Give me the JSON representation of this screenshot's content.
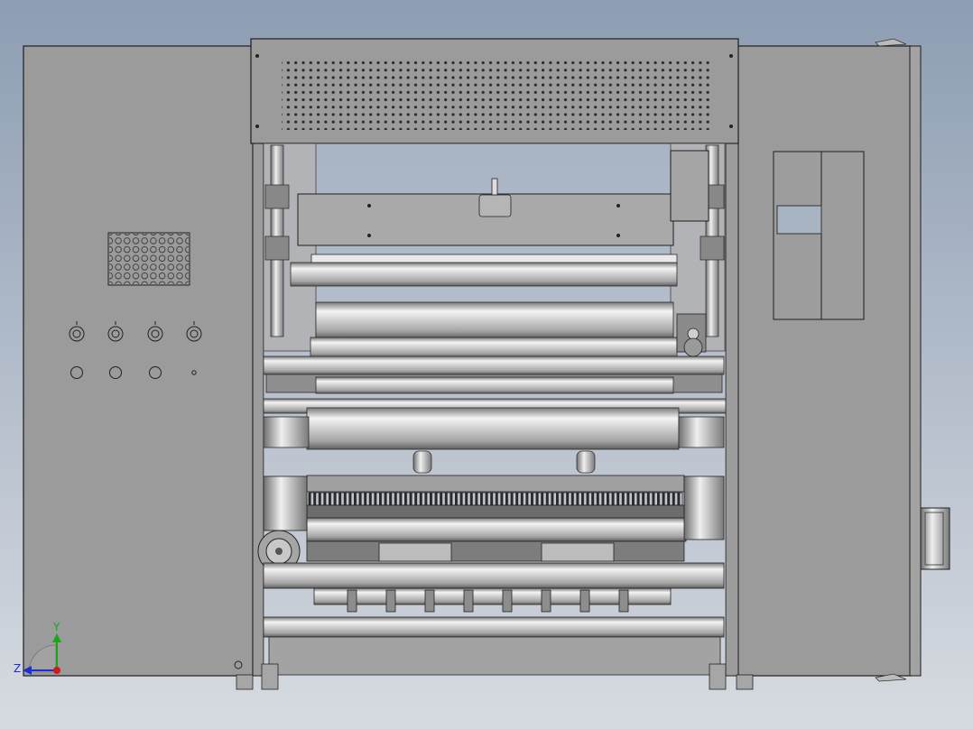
{
  "viewport": {
    "background_top": "#8d9db3",
    "background_bottom": "#d7dbe1",
    "body_color": "#9b9b9b",
    "line_color": "#1e1e1e",
    "roller_light": "#f2f2f2",
    "roller_dark": "#6c6c6c"
  },
  "triad": {
    "y_label": "Y",
    "z_label": "Z",
    "y_color": "#19a619",
    "z_color": "#1a2fd6",
    "x_color": "#d21a1a"
  }
}
